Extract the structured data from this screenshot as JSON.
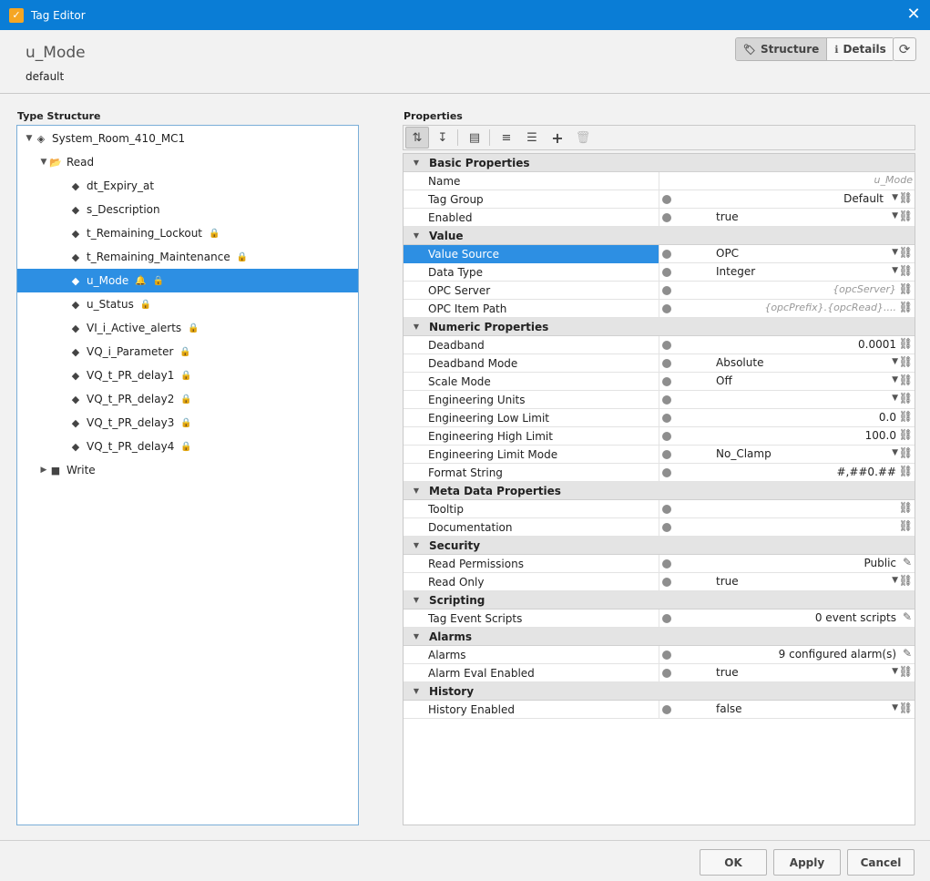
{
  "window": {
    "title": "Tag Editor"
  },
  "header": {
    "tag_name": "u_Mode",
    "provider": "default",
    "structure_label": "Structure",
    "details_label": "Details"
  },
  "type_structure": {
    "label": "Type Structure",
    "root": "System_Room_410_MC1",
    "read_folder": "Read",
    "read_items": [
      {
        "label": "dt_Expiry_at",
        "locked": false,
        "alarm": false,
        "selected": false
      },
      {
        "label": "s_Description",
        "locked": false,
        "alarm": false,
        "selected": false
      },
      {
        "label": "t_Remaining_Lockout",
        "locked": true,
        "alarm": false,
        "selected": false
      },
      {
        "label": "t_Remaining_Maintenance",
        "locked": true,
        "alarm": false,
        "selected": false
      },
      {
        "label": "u_Mode",
        "locked": true,
        "alarm": true,
        "selected": true
      },
      {
        "label": "u_Status",
        "locked": true,
        "alarm": false,
        "selected": false
      },
      {
        "label": "VI_i_Active_alerts",
        "locked": true,
        "alarm": false,
        "selected": false
      },
      {
        "label": "VQ_i_Parameter",
        "locked": true,
        "alarm": false,
        "selected": false
      },
      {
        "label": "VQ_t_PR_delay1",
        "locked": true,
        "alarm": false,
        "selected": false
      },
      {
        "label": "VQ_t_PR_delay2",
        "locked": true,
        "alarm": false,
        "selected": false
      },
      {
        "label": "VQ_t_PR_delay3",
        "locked": true,
        "alarm": false,
        "selected": false
      },
      {
        "label": "VQ_t_PR_delay4",
        "locked": true,
        "alarm": false,
        "selected": false
      }
    ],
    "write_folder": "Write"
  },
  "properties": {
    "label": "Properties",
    "rows": [
      {
        "type": "cat",
        "name": "Basic Properties"
      },
      {
        "type": "prop",
        "name": "Name",
        "value": "u_Mode",
        "align": "right",
        "style": "italic",
        "dot": false,
        "dropdown": false,
        "icon": "none"
      },
      {
        "type": "prop",
        "name": "Tag Group",
        "value": "Default",
        "align": "right",
        "style": "normal",
        "dot": true,
        "dropdown": true,
        "icon": "link"
      },
      {
        "type": "prop",
        "name": "Enabled",
        "value": "true",
        "align": "left",
        "style": "normal",
        "dot": true,
        "dropdown": true,
        "icon": "link"
      },
      {
        "type": "cat",
        "name": "Value"
      },
      {
        "type": "prop",
        "name": "Value Source",
        "value": "OPC",
        "align": "left",
        "style": "normal",
        "dot": true,
        "dropdown": true,
        "icon": "link",
        "selected": true
      },
      {
        "type": "prop",
        "name": "Data Type",
        "value": "Integer",
        "align": "left",
        "style": "normal",
        "dot": true,
        "dropdown": true,
        "icon": "link"
      },
      {
        "type": "prop",
        "name": "OPC Server",
        "value": "{opcServer}",
        "align": "right",
        "style": "italic",
        "dot": true,
        "dropdown": false,
        "icon": "link"
      },
      {
        "type": "prop",
        "name": "OPC Item Path",
        "value": "{opcPrefix}.{opcRead}....",
        "align": "right",
        "style": "italic",
        "dot": true,
        "dropdown": false,
        "icon": "link"
      },
      {
        "type": "cat",
        "name": "Numeric Properties"
      },
      {
        "type": "prop",
        "name": "Deadband",
        "value": "0.0001",
        "align": "right",
        "style": "normal",
        "dot": true,
        "dropdown": false,
        "icon": "link"
      },
      {
        "type": "prop",
        "name": "Deadband Mode",
        "value": "Absolute",
        "align": "left",
        "style": "normal",
        "dot": true,
        "dropdown": true,
        "icon": "link"
      },
      {
        "type": "prop",
        "name": "Scale Mode",
        "value": "Off",
        "align": "left",
        "style": "normal",
        "dot": true,
        "dropdown": true,
        "icon": "link"
      },
      {
        "type": "prop",
        "name": "Engineering Units",
        "value": "",
        "align": "left",
        "style": "normal",
        "dot": true,
        "dropdown": true,
        "icon": "link"
      },
      {
        "type": "prop",
        "name": "Engineering Low Limit",
        "value": "0.0",
        "align": "right",
        "style": "normal",
        "dot": true,
        "dropdown": false,
        "icon": "link"
      },
      {
        "type": "prop",
        "name": "Engineering High Limit",
        "value": "100.0",
        "align": "right",
        "style": "normal",
        "dot": true,
        "dropdown": false,
        "icon": "link"
      },
      {
        "type": "prop",
        "name": "Engineering Limit Mode",
        "value": "No_Clamp",
        "align": "left",
        "style": "normal",
        "dot": true,
        "dropdown": true,
        "icon": "link"
      },
      {
        "type": "prop",
        "name": "Format String",
        "value": "#,##0.##",
        "align": "right",
        "style": "normal",
        "dot": true,
        "dropdown": false,
        "icon": "link"
      },
      {
        "type": "cat",
        "name": "Meta Data Properties"
      },
      {
        "type": "prop",
        "name": "Tooltip",
        "value": "",
        "align": "right",
        "style": "normal",
        "dot": true,
        "dropdown": false,
        "icon": "link"
      },
      {
        "type": "prop",
        "name": "Documentation",
        "value": "",
        "align": "right",
        "style": "normal",
        "dot": true,
        "dropdown": false,
        "icon": "link"
      },
      {
        "type": "cat",
        "name": "Security"
      },
      {
        "type": "prop",
        "name": "Read Permissions",
        "value": "Public",
        "align": "right",
        "style": "normal",
        "dot": true,
        "dropdown": false,
        "icon": "edit"
      },
      {
        "type": "prop",
        "name": "Read Only",
        "value": "true",
        "align": "left",
        "style": "normal",
        "dot": true,
        "dropdown": true,
        "icon": "link"
      },
      {
        "type": "cat",
        "name": "Scripting"
      },
      {
        "type": "prop",
        "name": "Tag Event Scripts",
        "value": "0 event scripts",
        "align": "right",
        "style": "normal",
        "dot": true,
        "dropdown": false,
        "icon": "edit"
      },
      {
        "type": "cat",
        "name": "Alarms"
      },
      {
        "type": "prop",
        "name": "Alarms",
        "value": "9 configured alarm(s)",
        "align": "right",
        "style": "normal",
        "dot": true,
        "dropdown": false,
        "icon": "edit"
      },
      {
        "type": "prop",
        "name": "Alarm Eval Enabled",
        "value": "true",
        "align": "left",
        "style": "normal",
        "dot": true,
        "dropdown": true,
        "icon": "link"
      },
      {
        "type": "cat",
        "name": "History"
      },
      {
        "type": "prop",
        "name": "History Enabled",
        "value": "false",
        "align": "left",
        "style": "normal",
        "dot": true,
        "dropdown": true,
        "icon": "link"
      }
    ]
  },
  "footer": {
    "ok_label": "OK",
    "apply_label": "Apply",
    "cancel_label": "Cancel"
  },
  "colors": {
    "titlebar": "#0a7dd6",
    "selection": "#2d8fe3"
  }
}
